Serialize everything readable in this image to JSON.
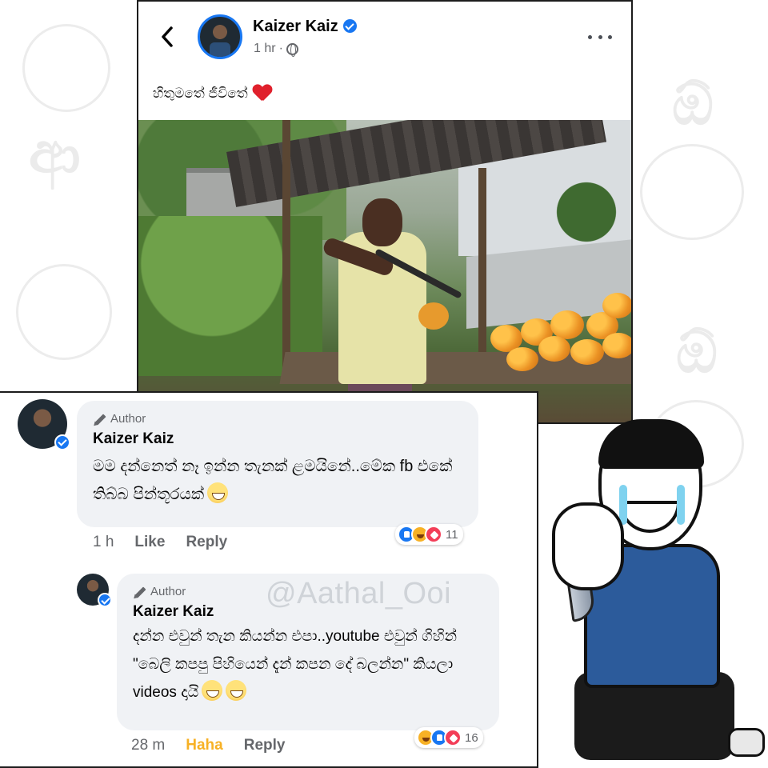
{
  "post": {
    "author": "Kaizer Kaiz",
    "time": "1 hr",
    "separator": "·",
    "text": "හිතුමතේ ජීවිතේ",
    "back_icon": "chevron-left-icon",
    "more_icon": "more-horizontal-icon",
    "privacy_icon": "globe-icon",
    "emoji": "red-heart"
  },
  "comments": [
    {
      "author_tag": "Author",
      "name": "Kaizer Kaiz",
      "text": "මම දන්නෙත් නෑ ඉන්න තැනක් ළමයිනේ..මේක fb එකේ තිබ්බ පින්තූරයක්",
      "time": "1 h",
      "like_label": "Like",
      "reply_label": "Reply",
      "reaction_count": "11",
      "reactions": [
        "like",
        "haha",
        "love"
      ]
    },
    {
      "author_tag": "Author",
      "name": "Kaizer Kaiz",
      "text": "දන්න එවුන් තැන කියන්න එපා..youtube එවුන් ගිහින් \"බෙලි කපපු පිහියෙන් දැන් කපන දේ බලන්න\" කියලා videos දායි",
      "time": "28 m",
      "like_label": "Haha",
      "reply_label": "Reply",
      "reaction_count": "16",
      "reactions": [
        "haha",
        "like",
        "love"
      ]
    }
  ],
  "watermark": "@Aathal_Ooi",
  "colors": {
    "accent": "#1877f2",
    "haha": "#f7b125",
    "love": "#f33e58",
    "bubble": "#f0f2f5",
    "meta": "#65676b"
  }
}
